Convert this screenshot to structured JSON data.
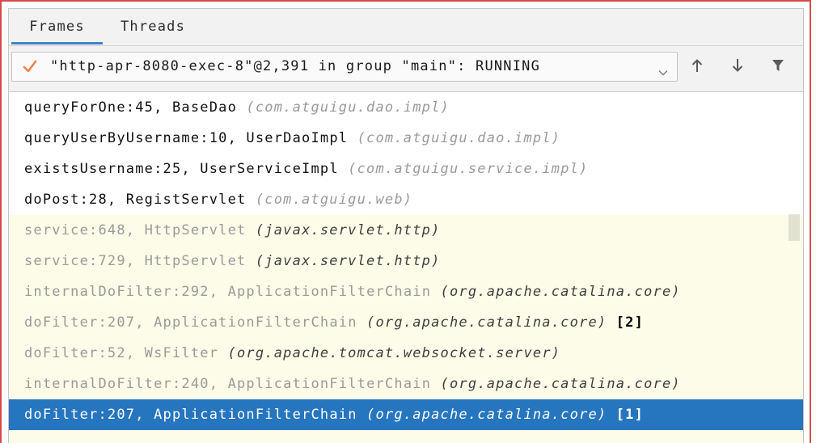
{
  "tabs": {
    "frames": {
      "label": "Frames",
      "active": true
    },
    "threads": {
      "label": "Threads",
      "active": false
    }
  },
  "thread_selector": {
    "status_icon": "check-icon",
    "value": "\"http-apr-8080-exec-8\"@2,391 in group \"main\": RUNNING",
    "dropdown_icon": "chevron-down-icon"
  },
  "toolbar": {
    "up_icon": "arrow-up-icon",
    "down_icon": "arrow-down-icon",
    "filter_icon": "filter-icon"
  },
  "frames": [
    {
      "label": "queryForOne:45, BaseDao",
      "package": "(com.atguigu.dao.impl)",
      "library": false,
      "selected": false
    },
    {
      "label": "queryUserByUsername:10, UserDaoImpl",
      "package": "(com.atguigu.dao.impl)",
      "library": false,
      "selected": false
    },
    {
      "label": "existsUsername:25, UserServiceImpl",
      "package": "(com.atguigu.service.impl)",
      "library": false,
      "selected": false
    },
    {
      "label": "doPost:28, RegistServlet",
      "package": "(com.atguigu.web)",
      "library": false,
      "selected": false
    },
    {
      "label": "service:648, HttpServlet",
      "package": "(javax.servlet.http)",
      "library": true,
      "selected": false
    },
    {
      "label": "service:729, HttpServlet",
      "package": "(javax.servlet.http)",
      "library": true,
      "selected": false
    },
    {
      "label": "internalDoFilter:292, ApplicationFilterChain",
      "package": "(org.apache.catalina.core)",
      "library": true,
      "selected": false
    },
    {
      "label": "doFilter:207, ApplicationFilterChain",
      "package": "(org.apache.catalina.core)",
      "marker": "[2]",
      "library": true,
      "selected": false
    },
    {
      "label": "doFilter:52, WsFilter",
      "package": "(org.apache.tomcat.websocket.server)",
      "library": true,
      "selected": false
    },
    {
      "label": "internalDoFilter:240, ApplicationFilterChain",
      "package": "(org.apache.catalina.core)",
      "library": true,
      "selected": false
    },
    {
      "label": "doFilter:207, ApplicationFilterChain",
      "package": "(org.apache.catalina.core)",
      "marker": "[1]",
      "library": true,
      "selected": true
    }
  ],
  "colors": {
    "selection": "#2675bf",
    "library_frame_bg": "#fcfce9",
    "active_tab_underline": "#4083c9",
    "running_check": "#f0804a",
    "highlight_outline": "#d94a4a"
  }
}
